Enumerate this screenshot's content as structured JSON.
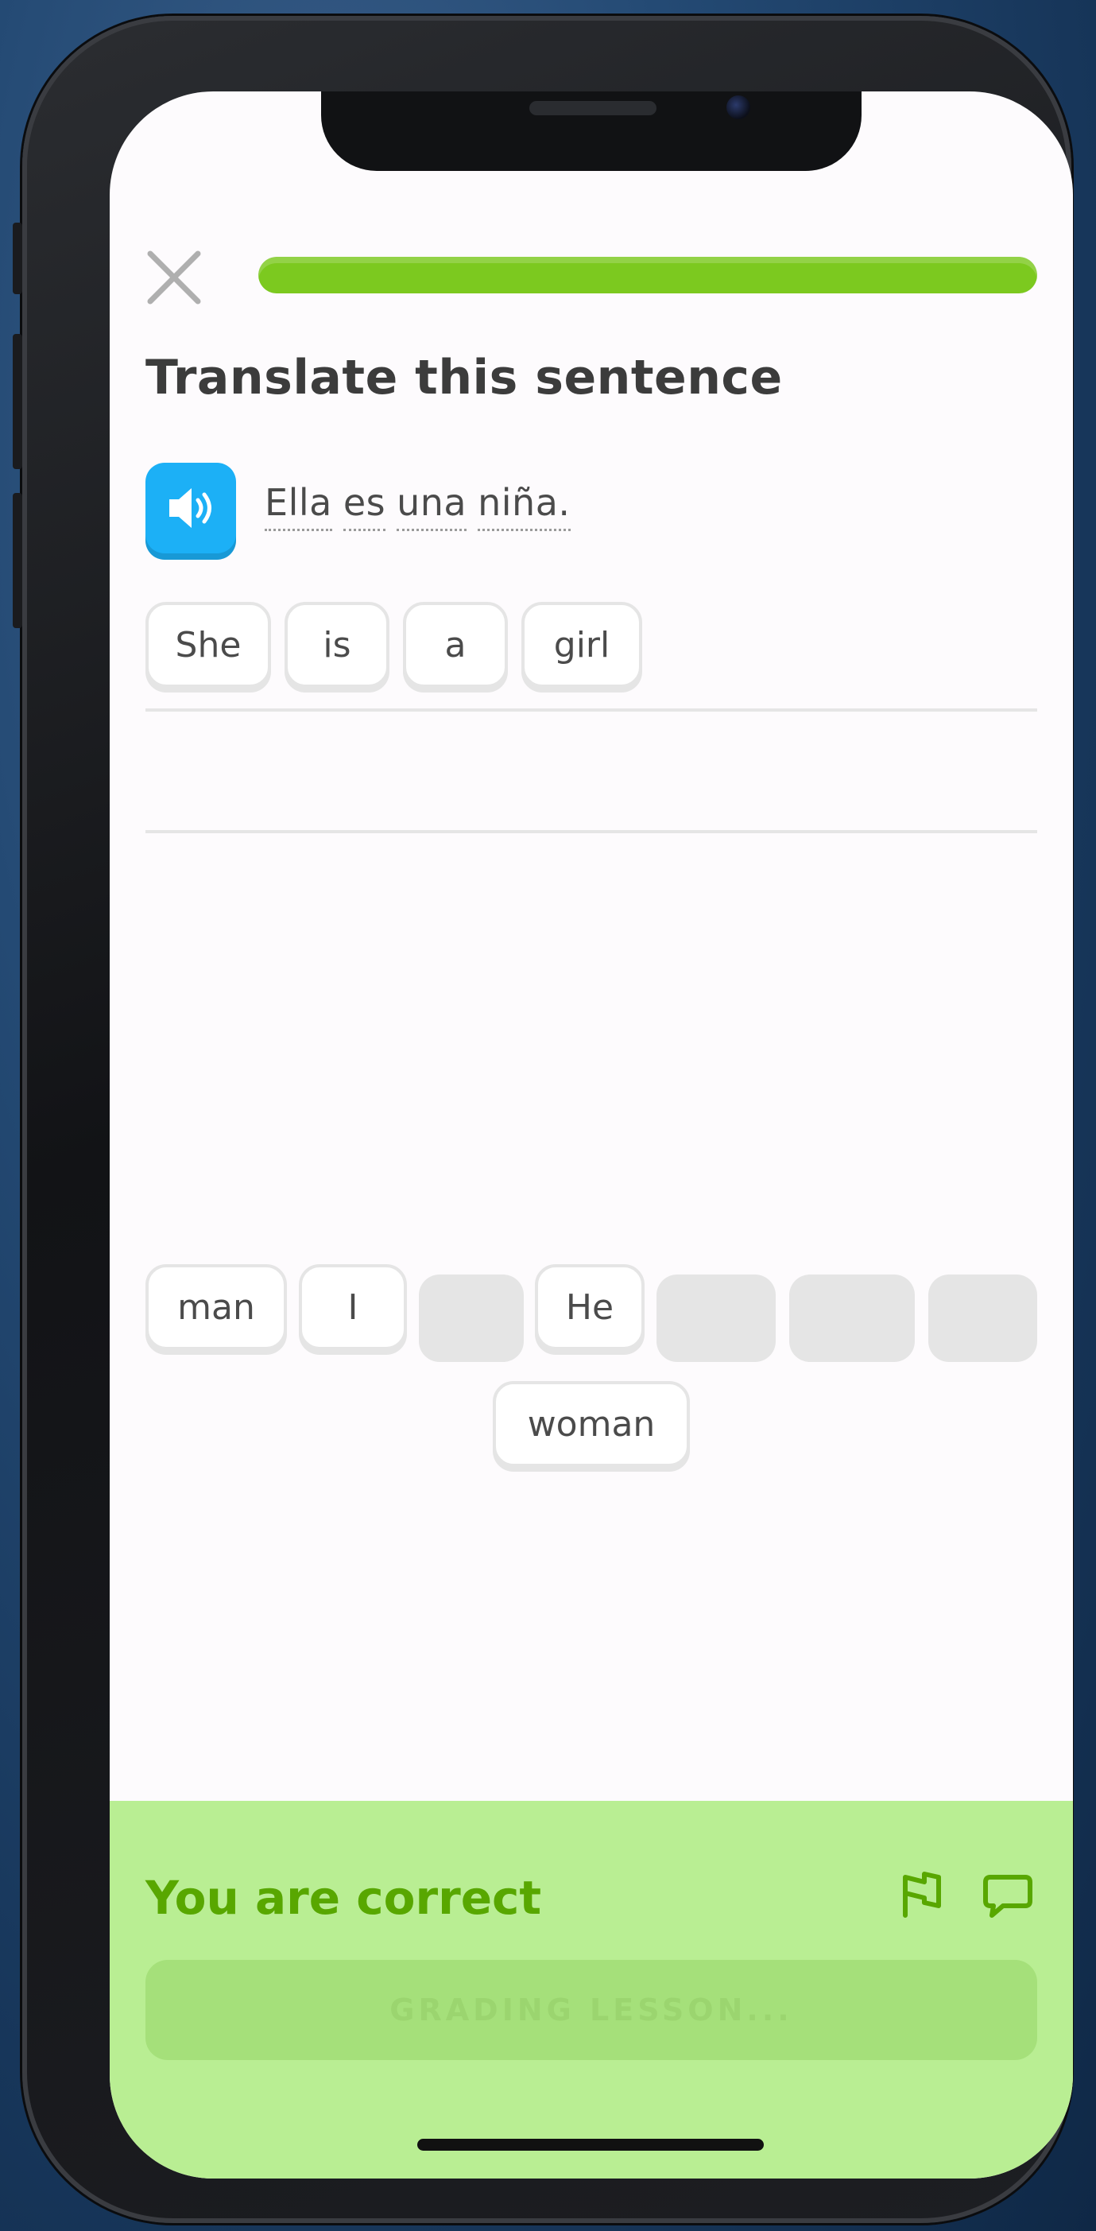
{
  "header": {
    "progress_fraction": 1.0
  },
  "exercise": {
    "title": "Translate this sentence",
    "prompt_words": [
      "Ella",
      "es",
      "una",
      "niña."
    ],
    "answer_words": [
      "She",
      "is",
      "a",
      "girl"
    ],
    "word_bank": [
      "man",
      "I",
      "He",
      "woman"
    ]
  },
  "footer": {
    "feedback": "You are correct",
    "button_label": "GRADING LESSON..."
  },
  "icons": {
    "close": "close-icon",
    "audio": "speaker-icon",
    "report": "flag-icon",
    "discuss": "comment-icon"
  },
  "colors": {
    "progress": "#7cc91f",
    "audio_button": "#1cb0f6",
    "feedback_background": "#b9ee93",
    "feedback_text": "#58a700"
  }
}
